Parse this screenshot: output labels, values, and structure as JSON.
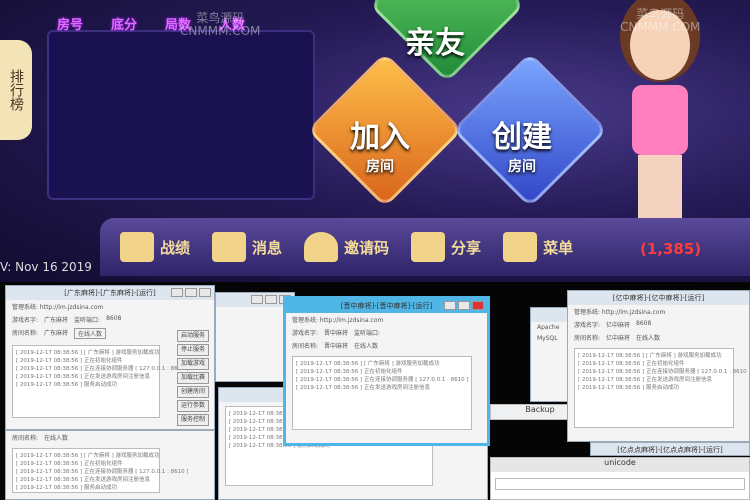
{
  "game": {
    "tabs": [
      "房号",
      "底分",
      "局数",
      "人数"
    ],
    "ranking": "排行榜",
    "friends": "亲友",
    "join": {
      "big": "加入",
      "small": "房间"
    },
    "create": {
      "big": "创建",
      "small": "房间"
    },
    "menu": [
      {
        "label": "战绩",
        "icon": "bar-chart-icon"
      },
      {
        "label": "消息",
        "icon": "envelope-icon"
      },
      {
        "label": "邀请码",
        "icon": "user-icon"
      },
      {
        "label": "分享",
        "icon": "share-icon"
      },
      {
        "label": "菜单",
        "icon": "folder-icon"
      }
    ],
    "version": "V: Nov 16 2019",
    "counter": "(1,385)",
    "watermark": {
      "cn": "菜鸟源码",
      "en": "CNMMM.COM"
    }
  },
  "windows": [
    {
      "title": "[广东麻将]-[广东麻将]-[运行]",
      "site": "管理系统: http://lm.jzdsina.com",
      "game_label": "游戏名字:",
      "game_value": "广东麻将",
      "port_label": "监听端口:",
      "port_value": "8608",
      "room_label": "房间名称:",
      "room_value": "广东麻将",
      "online": "在线人数",
      "logs": [
        "[ 2019-12-17 08:38:56 ] [ 广东麻将 ] 游戏服务加载成功",
        "[ 2019-12-17 08:38:56 ] 正在初始化组件",
        "[ 2019-12-17 08:38:56 ] 正在连接协调服务器 [ 127.0.0.1 : 8610 ]",
        "[ 2019-12-17 08:38:56 ] 正在发送游戏房间注册信息",
        "[ 2019-12-17 08:38:56 ] 服务启动成功"
      ],
      "buttons": [
        "启动服务",
        "停止服务",
        "加载游戏",
        "加载比赛",
        "创建房间",
        "运行参数",
        "服务控制"
      ]
    },
    {
      "title": "[晋中麻将]-[晋中麻将]-[运行]",
      "game_value": "晋中麻将",
      "room_value": "晋中麻将"
    },
    {
      "title": "[亿中麻将]-[亿中麻将]-[运行]",
      "game_value": "亿中麻将",
      "room_value": "亿中麻将"
    },
    {
      "title": "[亿点点麻将]-[亿点点麻将]-[运行]"
    }
  ],
  "misc": {
    "backup": "Backup",
    "unicode": "unicode",
    "apache": "Apache",
    "mysql": "MySQL"
  }
}
